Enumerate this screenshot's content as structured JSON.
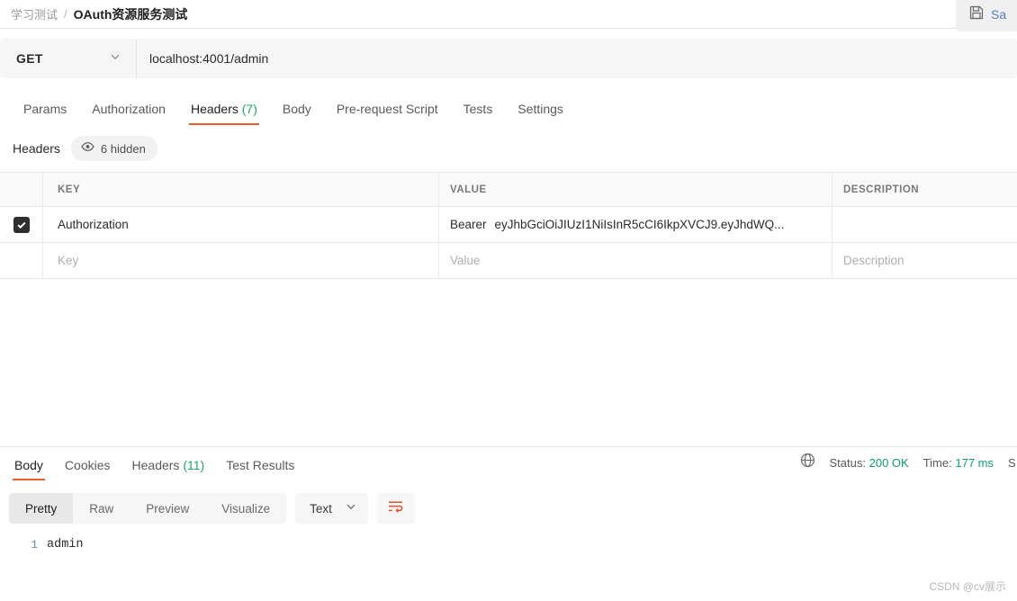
{
  "breadcrumb": {
    "parent": "学习测试",
    "separator": "/",
    "current": "OAuth资源服务测试"
  },
  "save_button": {
    "label": "Sa",
    "icon": "save-floppy-icon"
  },
  "request": {
    "method": "GET",
    "url": "localhost:4001/admin",
    "tabs": [
      {
        "label": "Params",
        "count": "",
        "active": false
      },
      {
        "label": "Authorization",
        "count": "",
        "active": false
      },
      {
        "label": "Headers",
        "count": "(7)",
        "active": true
      },
      {
        "label": "Body",
        "count": "",
        "active": false
      },
      {
        "label": "Pre-request Script",
        "count": "",
        "active": false
      },
      {
        "label": "Tests",
        "count": "",
        "active": false
      },
      {
        "label": "Settings",
        "count": "",
        "active": false
      }
    ]
  },
  "headers_section": {
    "title": "Headers",
    "hidden_pill": "6 hidden",
    "columns": {
      "key": "KEY",
      "value": "VALUE",
      "description": "DESCRIPTION"
    },
    "rows": [
      {
        "checked": true,
        "key": "Authorization",
        "value_prefix": "Bearer",
        "value_token": "eyJhbGciOiJIUzI1NiIsInR5cCI6IkpXVCJ9.eyJhdWQ...",
        "description": ""
      }
    ],
    "placeholder_row": {
      "key": "Key",
      "value": "Value",
      "description": "Description"
    }
  },
  "response": {
    "tabs": [
      {
        "label": "Body",
        "count": "",
        "active": true
      },
      {
        "label": "Cookies",
        "count": "",
        "active": false
      },
      {
        "label": "Headers",
        "count": "(11)",
        "active": false
      },
      {
        "label": "Test Results",
        "count": "",
        "active": false
      }
    ],
    "meta": {
      "status_label": "Status:",
      "status_value": "200 OK",
      "time_label": "Time:",
      "time_value": "177 ms",
      "size_label": "S"
    },
    "toolbar": {
      "formats": [
        {
          "label": "Pretty",
          "active": true
        },
        {
          "label": "Raw",
          "active": false
        },
        {
          "label": "Preview",
          "active": false
        },
        {
          "label": "Visualize",
          "active": false
        }
      ],
      "type": "Text",
      "wrap_icon": "word-wrap-icon"
    },
    "body": {
      "lines": [
        {
          "number": "1",
          "text": "admin"
        }
      ]
    }
  },
  "watermark": "CSDN @cv展示",
  "colors": {
    "accent": "#ef5b25",
    "success": "#0f9f6e",
    "link": "#5a7dbf"
  }
}
